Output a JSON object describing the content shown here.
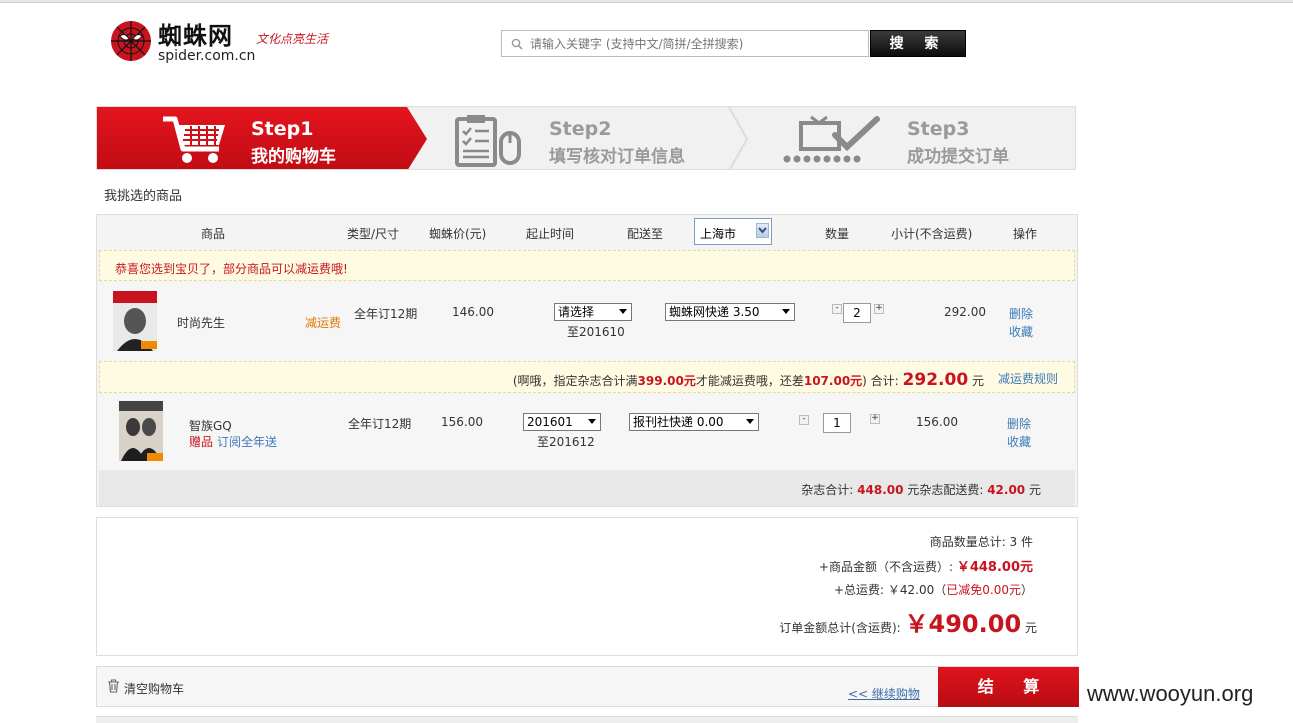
{
  "header": {
    "logo_name": "蜘蛛网",
    "logo_slogan": "文化点亮生活",
    "logo_url": "spider.com.cn",
    "search_placeholder": "请输入关键字 (支持中文/简拼/全拼搜索)",
    "search_button": "搜 索"
  },
  "steps": [
    {
      "title": "Step1",
      "sub": "我的购物车",
      "active": true
    },
    {
      "title": "Step2",
      "sub": "填写核对订单信息",
      "active": false
    },
    {
      "title": "Step3",
      "sub": "成功提交订单",
      "active": false
    }
  ],
  "section_title": "我挑选的商品",
  "table": {
    "headers": {
      "product": "商品",
      "type": "类型/尺寸",
      "price": "蜘蛛价(元)",
      "period": "起止时间",
      "ship_to": "配送至",
      "quantity": "数量",
      "subtotal": "小计(不含运费)",
      "action": "操作"
    },
    "region": "上海市",
    "notice": "恭喜您选到宝贝了，部分商品可以减运费哦!",
    "items": [
      {
        "name": "时尚先生",
        "tag": "减运费",
        "type": "全年订12期",
        "price": "146.00",
        "start": "请选择",
        "end": "至201610",
        "shipping": "蜘蛛网快递   3.50",
        "qty": "2",
        "subtotal": "292.00",
        "delete": "删除",
        "favorite": "收藏"
      },
      {
        "name": "智族GQ",
        "gift": "赠品",
        "gift_text": "订阅全年送",
        "type": "全年订12期",
        "price": "156.00",
        "start": "201601",
        "end": "至201612",
        "shipping": "报刊社快递   0.00",
        "qty": "1",
        "subtotal": "156.00",
        "delete": "删除",
        "favorite": "收藏"
      }
    ],
    "promo": {
      "prefix": "(啊哦，指定杂志合计满",
      "threshold": "399.00元",
      "middle": "才能减运费哦，还差",
      "diff": "107.00元",
      "suffix": ") 合计:",
      "total": "292.00",
      "unit": "元",
      "rule_link": "减运费规则"
    },
    "totals": {
      "mag_label": "杂志合计:",
      "mag_value": "448.00",
      "unit": "元",
      "ship_label": "杂志配送费:",
      "ship_value": "42.00"
    }
  },
  "summary": {
    "count_label": "商品数量总计: 3 件",
    "amount_label": "+商品金额（不含运费）:",
    "amount_value": "￥448.00元",
    "shipping_label": "+总运费: ￥42.00（",
    "shipping_saved": "已减免0.00元",
    "shipping_close": "）",
    "grand_label": "订单金额总计(含运费):",
    "grand_value": "￥490.00",
    "grand_unit": "元"
  },
  "bottom": {
    "clear": "清空购物车",
    "continue": "<< 继续购物",
    "checkout": "结 算"
  },
  "watermark": "www.wooyun.org",
  "colors": {
    "brand_red": "#c8141e",
    "link_blue": "#3d7ab8"
  }
}
